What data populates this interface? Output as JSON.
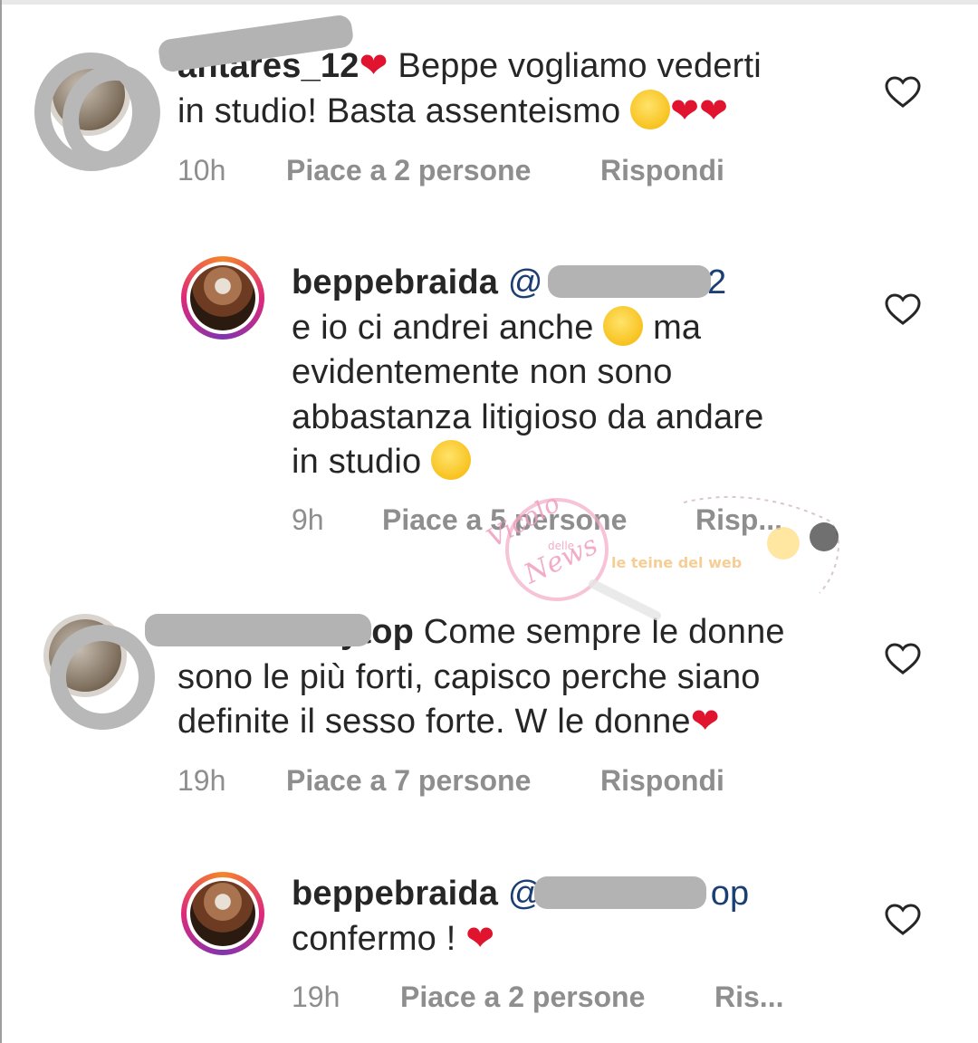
{
  "comments": [
    {
      "username": "antares_12",
      "text_line1": " Beppe vogliamo vederti",
      "text_line2": "in studio! Basta assenteismo ",
      "time": "10h",
      "likes": "Piace a 2 persone",
      "reply": "Rispondi"
    },
    {
      "username": "beppebraida",
      "mention": "@",
      "mention_tail": "12",
      "text_line1": "e io ci andrei anche ",
      "text_line1_tail": " ma",
      "text_line2": "evidentemente non sono",
      "text_line3": "abbastanza litigioso da andare",
      "text_line4": "in studio ",
      "time": "9h",
      "likes": "Piace a 5 persone",
      "reply": "Risp..."
    },
    {
      "username": "ytop",
      "text_line1": " Come sempre le donne",
      "text_line2": "sono le più forti, capisco perche siano",
      "text_line3": "definite il sesso forte. W le donne",
      "time": "19h",
      "likes": "Piace a 7 persone",
      "reply": "Rispondi"
    },
    {
      "username": "beppebraida",
      "mention": "@",
      "mention_tail": "op",
      "text_line1": "confermo ! ",
      "time": "19h",
      "likes": "Piace a 2 persone",
      "reply": "Ris..."
    }
  ],
  "watermark": {
    "line1": "Vicolo",
    "line2": "delle",
    "line3": "News",
    "tagline": "le teine del web"
  },
  "icons": {
    "like": "heart-outline-icon",
    "heart": "red-heart-emoji",
    "grin": "grinning-emoji",
    "smile": "smiling-emoji",
    "wink": "winking-emoji"
  },
  "colors": {
    "text": "#262626",
    "meta": "#8e8e8e",
    "mention": "#1b3f73",
    "heart": "#e0142e",
    "redaction": "#b3b3b3"
  }
}
